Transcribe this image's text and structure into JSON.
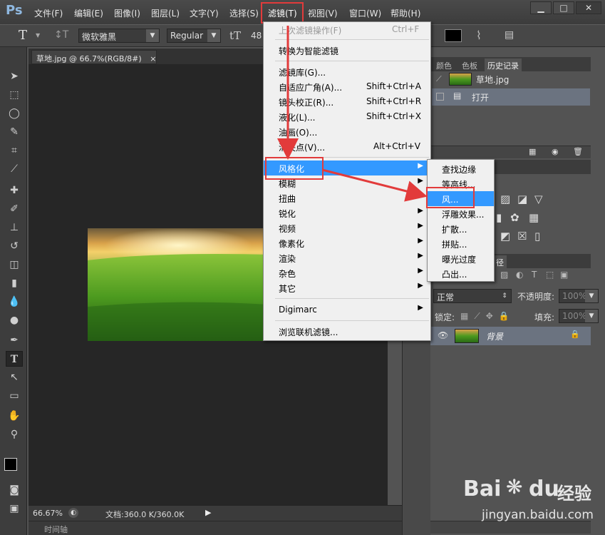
{
  "app": {
    "logo": "Ps"
  },
  "menubar": {
    "items": [
      "文件(F)",
      "编辑(E)",
      "图像(I)",
      "图层(L)",
      "文字(Y)",
      "选择(S)",
      "滤镜(T)",
      "视图(V)",
      "窗口(W)",
      "帮助(H)"
    ],
    "window_buttons": {
      "minimize": "▁",
      "maximize": "□",
      "close": "✕"
    }
  },
  "options": {
    "text_tool_icon": "T",
    "font_family": "微软雅黑",
    "font_style": "Regular",
    "size_icon": "tT",
    "font_size": "48"
  },
  "document": {
    "tab_title": "草地.jpg @ 66.7%(RGB/8#)",
    "tab_close": "×",
    "zoom": "66.67%",
    "doc_info": "文档:360.0 K/360.0K",
    "timeline_label": "时间轴"
  },
  "filter_menu": {
    "items": [
      {
        "label": "上次滤镜操作(F)",
        "shortcut": "Ctrl+F",
        "disabled": true
      },
      {
        "label": "转换为智能滤镜"
      },
      {
        "label": "滤镜库(G)..."
      },
      {
        "label": "自适应广角(A)...",
        "shortcut": "Shift+Ctrl+A"
      },
      {
        "label": "镜头校正(R)...",
        "shortcut": "Shift+Ctrl+R"
      },
      {
        "label": "液化(L)...",
        "shortcut": "Shift+Ctrl+X"
      },
      {
        "label": "油画(O)..."
      },
      {
        "label": "消失点(V)...",
        "shortcut": "Alt+Ctrl+V"
      },
      {
        "label": "风格化",
        "submenu": true,
        "highlighted": true
      },
      {
        "label": "模糊",
        "submenu": true
      },
      {
        "label": "扭曲",
        "submenu": true
      },
      {
        "label": "锐化",
        "submenu": true
      },
      {
        "label": "视频",
        "submenu": true
      },
      {
        "label": "像素化",
        "submenu": true
      },
      {
        "label": "渲染",
        "submenu": true
      },
      {
        "label": "杂色",
        "submenu": true
      },
      {
        "label": "其它",
        "submenu": true
      },
      {
        "label": "Digimarc",
        "submenu": true
      },
      {
        "label": "浏览联机滤镜..."
      }
    ]
  },
  "stylize_submenu": {
    "items": [
      "查找边缘",
      "等高线...",
      "风...",
      "浮雕效果...",
      "扩散...",
      "拼贴...",
      "曝光过度",
      "凸出..."
    ],
    "highlighted_index": 2
  },
  "panels": {
    "top_tabs": [
      "颜色",
      "色板",
      "历史记录"
    ],
    "history_snapshot": "草地.jpg",
    "history_step": "打开",
    "blend_mode": "正常",
    "opacity_label": "不透明度:",
    "opacity_value": "100%",
    "lock_label": "锁定:",
    "fill_label": "填充:",
    "fill_value": "100%",
    "layer_name": "背景",
    "paths_tab_fragment": "径"
  },
  "watermark": {
    "brand": "Bai",
    "brand2": "du",
    "jingyan": "经验",
    "url": "jingyan.baidu.com"
  },
  "colors": {
    "highlight": "#3399ff",
    "annotation_red": "#e23b3b",
    "menu_bg": "#f0f0f0"
  }
}
